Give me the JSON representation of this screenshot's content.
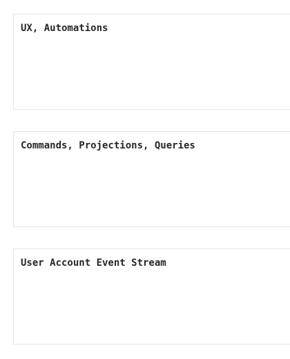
{
  "lanes": [
    {
      "label": "UX, Automations"
    },
    {
      "label": "Commands, Projections, Queries"
    },
    {
      "label": "User Account Event Stream"
    }
  ]
}
